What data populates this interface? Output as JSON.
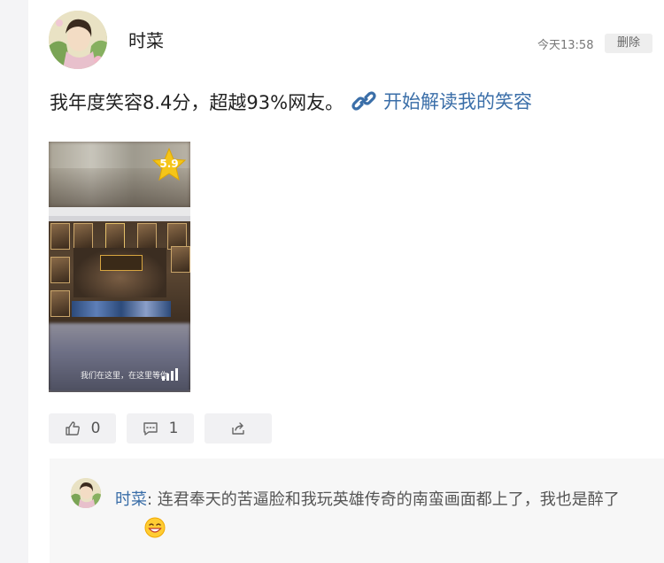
{
  "post": {
    "author": "时菜",
    "time": "今天13:58",
    "delete_label": "删除",
    "text": "我年度笑容8.4分，超越93%网友。",
    "link_label": "开始解读我的笑容",
    "photo": {
      "score": "5.9",
      "caption": "我们在这里，在这里等你"
    }
  },
  "actions": {
    "like_count": "0",
    "comment_count": "1"
  },
  "comment": {
    "author": "时菜",
    "separator": ": ",
    "text": "连君奉天的苦逼脸和我玩英雄传奇的南蛮画面都上了，我也是醉了"
  },
  "icons": {
    "link": "link-icon",
    "like": "thumbs-up-icon",
    "comment": "comment-icon",
    "share": "share-icon",
    "star": "star-badge-icon",
    "emoji": "grinning-emoji-icon"
  },
  "colors": {
    "link": "#3a6ea8",
    "button_bg": "#f1f1f3",
    "comment_bg": "#f7f7f7",
    "star": "#f5c518"
  }
}
